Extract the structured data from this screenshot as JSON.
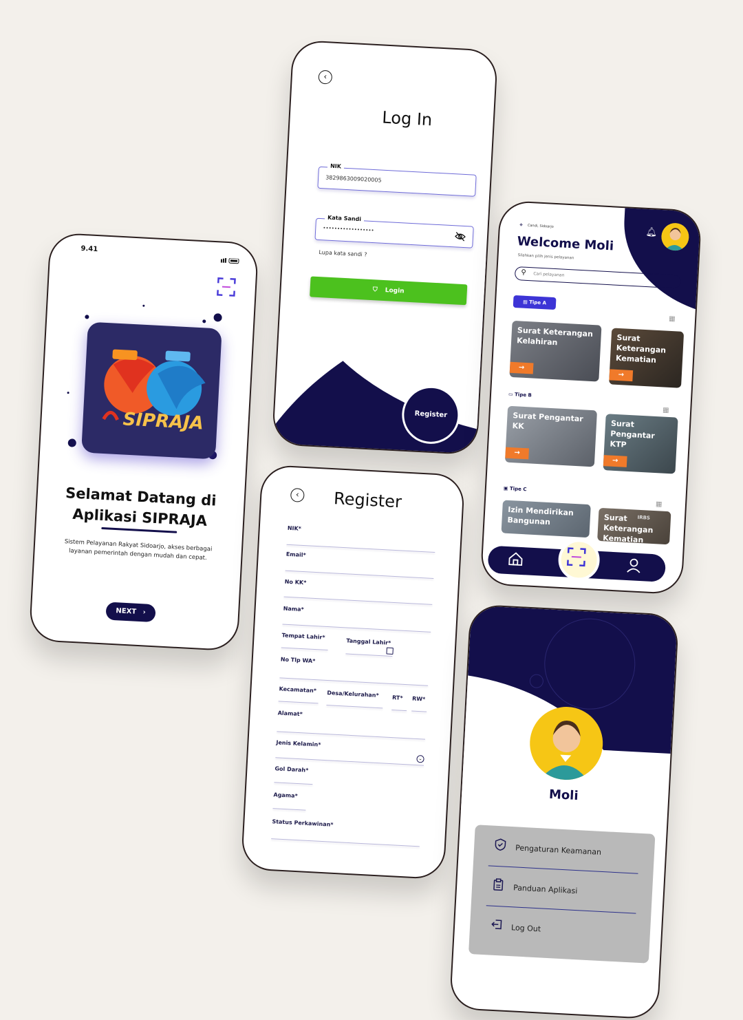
{
  "splash": {
    "time": "9.41",
    "logo_text": "SIPRAJA",
    "title_line1": "Selamat Datang di",
    "title_line2": "Aplikasi SIPRAJA",
    "subtitle": "Sistem Pelayanan Rakyat Sidoarjo, akses berbagai layanan pemerintah dengan mudah dan cepat.",
    "next_label": "NEXT",
    "accent": "#130f4b"
  },
  "login": {
    "title": "Log In",
    "nik_label": "NIK",
    "nik_value": "3829863009020005",
    "password_label": "Kata Sandi",
    "password_value": "••••••••••••••••••",
    "forgot": "Lupa kata sandi ?",
    "login_button": "Login",
    "register_button": "Register",
    "button_color": "#4cc11e"
  },
  "register": {
    "title": "Register",
    "fields": {
      "nik": "NIK*",
      "email": "Email*",
      "no_kk": "No KK*",
      "nama": "Nama*",
      "tempat_lahir": "Tempat Lahir*",
      "tanggal_lahir": "Tanggal Lahir*",
      "no_tlp": "No Tlp WA*",
      "kecamatan": "Kecamatan*",
      "desa": "Desa/Kelurahan*",
      "rt": "RT*",
      "rw": "RW*",
      "alamat": "Alamat*",
      "jenis_kelamin": "Jenis Kelamin*",
      "gol_darah": "Gol Darah*",
      "agama": "Agama*",
      "status": "Status Perkawinan*"
    }
  },
  "home": {
    "location": "Candi, Sidoarjo",
    "welcome": "Welcome Moli",
    "subtitle": "Silahkan pilih jenis pelayanan",
    "search_placeholder": "Cari pelayanan",
    "tipe_a": "Tipe A",
    "tipe_b": "Tipe B",
    "tipe_c": "Tipe C",
    "cards_a": [
      "Surat Keterangan Kelahiran",
      "Surat Keterangan Kematian"
    ],
    "cards_b": [
      "Surat Pengantar KK",
      "Surat Pengantar KTP"
    ],
    "cards_c": [
      "Izin Mendirikan Bangunan",
      "Surat Keterangan Kematian"
    ],
    "chip_color": "#3d34d6",
    "arrow_color": "#f07a2a",
    "card_a2_sign": "IRBS"
  },
  "profile": {
    "name": "Moli",
    "menu": [
      "Pengaturan Keamanan",
      "Panduan Aplikasi",
      "Log Out"
    ]
  }
}
